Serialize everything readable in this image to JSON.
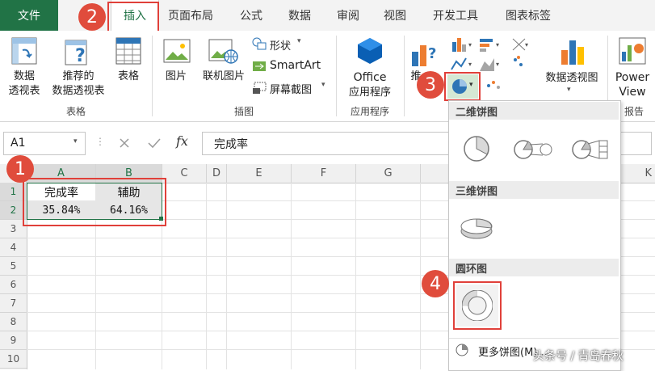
{
  "ribbon_tabs": {
    "file": "文件",
    "insert": "插入",
    "page_layout": "页面布局",
    "formulas": "公式",
    "data": "数据",
    "review": "审阅",
    "view": "视图",
    "developer": "开发工具",
    "chart_label": "图表标签"
  },
  "tables_group": {
    "pivot_table_line1": "数据",
    "pivot_table_line2": "透视表",
    "recommended_line1": "推荐的",
    "recommended_line2": "数据透视表",
    "table": "表格",
    "group_label": "表格"
  },
  "illustrations_group": {
    "picture": "图片",
    "online_picture": "联机图片",
    "shapes": "形状",
    "smartart": "SmartArt",
    "screenshot": "屏幕截图",
    "group_label": "插图"
  },
  "apps_group": {
    "office_line1": "Office",
    "office_line2": "应用程序",
    "group_label": "应用程序"
  },
  "charts_group": {
    "recommended_partial": "推",
    "pivot_chart": "数据透视图"
  },
  "reports_group": {
    "power_view_line1": "Power",
    "power_view_line2": "View",
    "group_label": "报告"
  },
  "formula_bar": {
    "name_box": "A1",
    "fx": "fx",
    "formula": "完成率"
  },
  "columns": [
    "A",
    "B",
    "C",
    "D",
    "E",
    "F",
    "G",
    "K"
  ],
  "rows": [
    "1",
    "2",
    "3",
    "4",
    "5",
    "6",
    "7",
    "8",
    "9",
    "10"
  ],
  "cells": {
    "A1": "完成率",
    "B1": "辅助",
    "A2": "35.84%",
    "B2": "64.16%"
  },
  "pie_dropdown": {
    "section_2d": "二维饼图",
    "section_3d": "三维饼图",
    "section_doughnut": "圆环图",
    "more_pie": "更多饼图(M)..."
  },
  "step_badges": [
    "1",
    "2",
    "3",
    "4"
  ],
  "watermark": "头条号 / 青岛春秋",
  "colors": {
    "excel_green": "#217346",
    "badge_red": "#e04c3c",
    "highlight_box": "#e0403a",
    "pie_blue": "#2e75b6"
  }
}
